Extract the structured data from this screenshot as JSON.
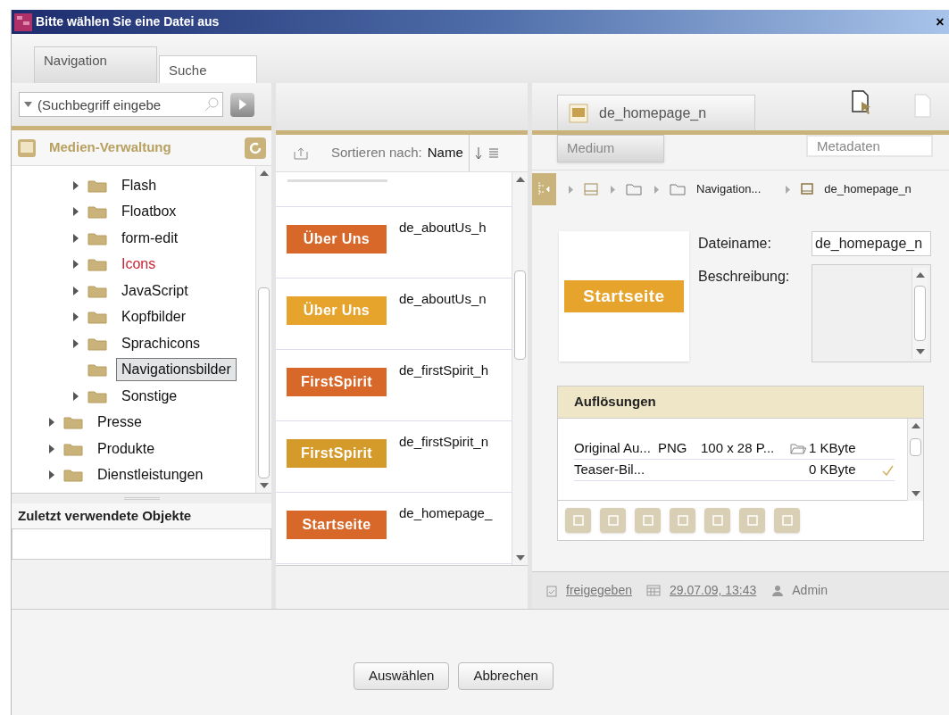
{
  "window": {
    "title": "Bitte wählen Sie eine Datei aus",
    "close": "×"
  },
  "tabs": [
    {
      "label": "Navigation",
      "selected": true
    },
    {
      "label": "Suche",
      "selected": false
    }
  ],
  "left": {
    "search": {
      "placeholder": "(Suchbegriff eingebe"
    },
    "header": "Medien-Verwaltung",
    "tree": [
      {
        "children": [
          {
            "label": "Flash",
            "expandable": true,
            "marked": false,
            "selected": false
          },
          {
            "label": "Floatbox",
            "expandable": true,
            "marked": false,
            "selected": false
          },
          {
            "label": "form-edit",
            "expandable": true,
            "marked": false,
            "selected": false
          },
          {
            "label": "Icons",
            "expandable": true,
            "marked": true,
            "selected": false
          },
          {
            "label": "JavaScript",
            "expandable": true,
            "marked": false,
            "selected": false
          },
          {
            "label": "Kopfbilder",
            "expandable": true,
            "marked": false,
            "selected": false
          },
          {
            "label": "Sprachicons",
            "expandable": true,
            "marked": false,
            "selected": false
          },
          {
            "label": "Navigationsbilder",
            "expandable": false,
            "marked": false,
            "selected": true
          },
          {
            "label": "Sonstige",
            "expandable": true,
            "marked": false,
            "selected": false
          }
        ]
      },
      {
        "label": "Presse",
        "expandable": true,
        "marked": false,
        "selected": false
      },
      {
        "label": "Produkte",
        "expandable": true,
        "marked": false,
        "selected": false
      },
      {
        "label": "Dienstleistungen",
        "expandable": true,
        "marked": false,
        "selected": false
      }
    ],
    "recent": {
      "title": "Zuletzt verwendete Objekte"
    }
  },
  "middle": {
    "sort_label": "Sortieren nach:",
    "sort_value": "Name",
    "items": [
      {
        "thumb": "Über Uns",
        "color": "#d8682a",
        "filename": "de_aboutUs_h"
      },
      {
        "thumb": "Über Uns",
        "color": "#e7a42c",
        "filename": "de_aboutUs_n"
      },
      {
        "thumb": "FirstSpirit",
        "color": "#d8682a",
        "filename": "de_firstSpirit_h"
      },
      {
        "thumb": "FirstSpirit",
        "color": "#d49a2a",
        "filename": "de_firstSpirit_n"
      },
      {
        "thumb": "Startseite",
        "color": "#d8682a",
        "filename": "de_homepage_"
      }
    ]
  },
  "right": {
    "file_tab": "de_homepage_n",
    "subtabs": [
      {
        "label": "Medium",
        "selected": true
      },
      {
        "label": "Metadaten",
        "selected": false
      }
    ],
    "breadcrumb": [
      {
        "kind": "media"
      },
      {
        "kind": "folder"
      },
      {
        "kind": "folder",
        "label": "Navigation..."
      },
      {
        "kind": "image",
        "label": "de_homepage_n"
      }
    ],
    "preview": {
      "thumb": "Startseite",
      "color": "#e7a42c"
    },
    "filename_label": "Dateiname:",
    "filename_value": "de_homepage_n",
    "description_label": "Beschreibung:",
    "resolutions": {
      "title": "Auflösungen",
      "rows": [
        {
          "name": "Original Au...",
          "format": "PNG",
          "size": "100 x 28 P...",
          "bytes": "1 KByte",
          "has_folder": true,
          "checked": false
        },
        {
          "name": "Teaser-Bil...",
          "bytes": "0 KByte",
          "has_folder": false,
          "checked": true
        }
      ]
    },
    "status": {
      "release": "freigegeben",
      "date": "29.07.09, 13:43",
      "user": "Admin"
    }
  },
  "buttons": [
    "Auswählen",
    "Abbrechen"
  ]
}
